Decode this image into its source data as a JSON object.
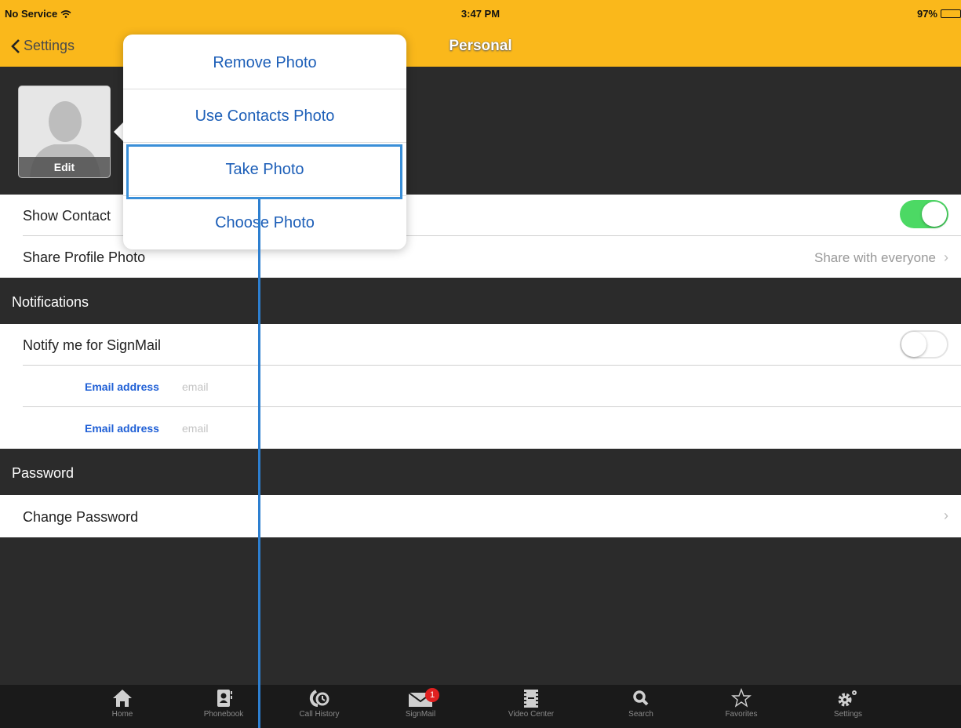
{
  "status_bar": {
    "carrier": "No Service",
    "time": "3:47 PM",
    "battery": "97%"
  },
  "nav": {
    "back_label": "Settings",
    "title": "Personal"
  },
  "avatar": {
    "edit_label": "Edit"
  },
  "rows": {
    "show_contact": {
      "label": "Show Contact",
      "toggle": "on"
    },
    "share_photo": {
      "label": "Share Profile Photo",
      "value": "Share with everyone"
    }
  },
  "sections": {
    "notifications": "Notifications",
    "password": "Password"
  },
  "notifications": {
    "signmail": {
      "label": "Notify me for SignMail",
      "toggle": "off"
    },
    "email1": {
      "label": "Email address",
      "placeholder": "email"
    },
    "email2": {
      "label": "Email address",
      "placeholder": "email"
    }
  },
  "password": {
    "change_label": "Change Password"
  },
  "popover": {
    "items": [
      "Remove Photo",
      "Use Contacts Photo",
      "Take Photo",
      "Choose Photo"
    ],
    "highlighted": "Take Photo"
  },
  "tabbar": {
    "items": [
      {
        "label": "Home",
        "icon": "home-icon"
      },
      {
        "label": "Phonebook",
        "icon": "phonebook-icon"
      },
      {
        "label": "Call History",
        "icon": "call-history-icon"
      },
      {
        "label": "SignMail",
        "icon": "signmail-icon",
        "badge": "1"
      },
      {
        "label": "Video Center",
        "icon": "video-center-icon"
      },
      {
        "label": "Search",
        "icon": "search-icon"
      },
      {
        "label": "Favorites",
        "icon": "star-icon"
      },
      {
        "label": "Settings",
        "icon": "gear-icon"
      }
    ]
  },
  "colors": {
    "accent": "#fab81b",
    "link": "#1d5fb8",
    "toggle_on": "#4cd964",
    "badge": "#e02020",
    "highlight": "#3a8fd8"
  }
}
